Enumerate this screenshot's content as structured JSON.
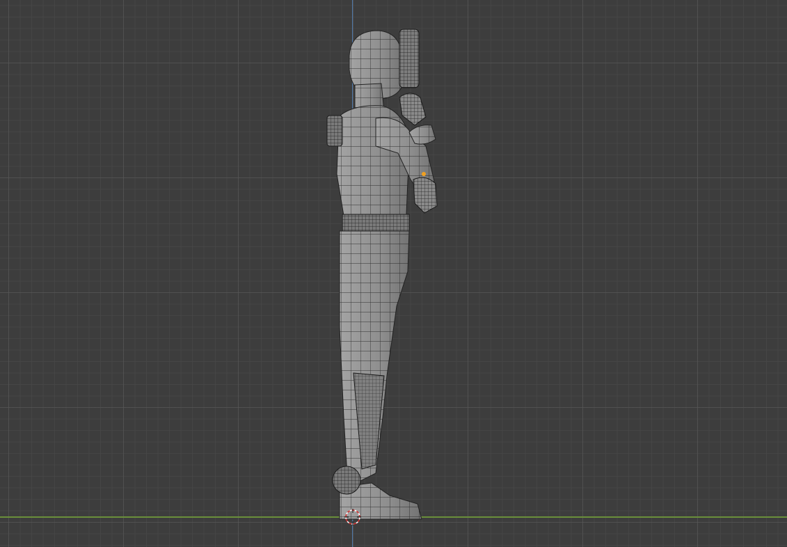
{
  "viewport": {
    "label": "3D Viewport",
    "view": "side-orthographic",
    "object": "character-mesh",
    "mode": "wireframe-overlay"
  },
  "colors": {
    "background": "#3d3d3d",
    "grid_minor": "#464646",
    "grid_major": "#5a5a5a",
    "z_axis": "#4f78a8",
    "y_axis": "#6a8f3a",
    "mesh_fill": "#8c8c8c",
    "mesh_wire": "#1c1c1c",
    "origin_dot": "#f0a020",
    "cursor_red": "#d03030"
  }
}
